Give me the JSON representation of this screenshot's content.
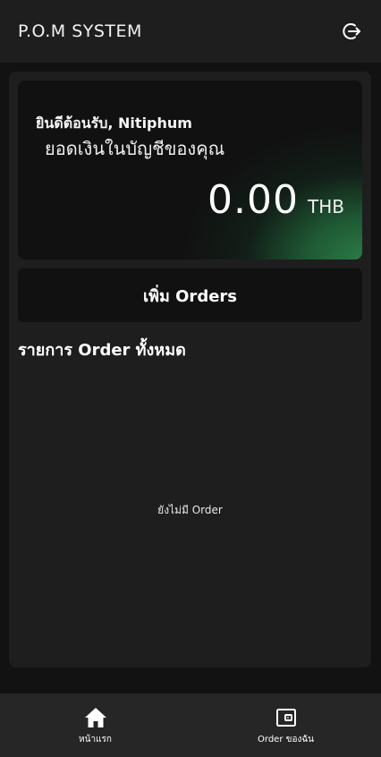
{
  "app_bar": {
    "title": "P.O.M SYSTEM",
    "logout_icon": "logout-icon"
  },
  "balance_card": {
    "welcome": "ยินดีต้อนรับ, Nitiphum",
    "label": "ยอดเงินในบัญชีของคุณ",
    "amount": "0.00",
    "currency": "THB",
    "accent_color": "#2b7a45"
  },
  "actions": {
    "add_orders": "เพิ่ม Orders"
  },
  "orders": {
    "section_title": "รายการ Order ทั้งหมด",
    "empty_message": "ยังไม่มี Order"
  },
  "bottom_nav": {
    "items": [
      {
        "label": "หน้าแรก",
        "icon": "home-icon"
      },
      {
        "label": "Order ของฉัน",
        "icon": "wallet-icon"
      }
    ]
  }
}
